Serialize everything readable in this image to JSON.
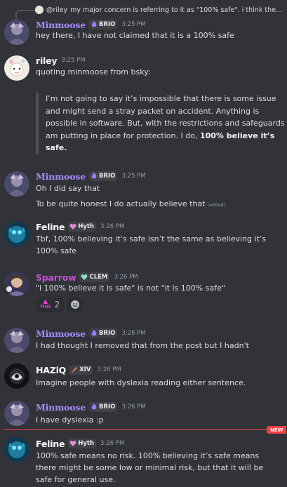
{
  "colors": {
    "background": "#313338",
    "minmoose": "#a88bff",
    "riley": "#f2f3f5",
    "feline": "#ffffff",
    "sparrow": "#c450d6",
    "haziq": "#ffffff",
    "new_marker": "#f23f43"
  },
  "reply": {
    "mention": "@riley",
    "text": "my major concern is referring to it as \"100% safe\". i think the..."
  },
  "messages": {
    "m1": {
      "username": "Minmoose",
      "tag": "BRIO",
      "time": "3:25 PM",
      "line1": "hey there, I have not claimed that it is a 100% safe"
    },
    "m2": {
      "username": "riley",
      "time": "3:25 PM",
      "line1": "quoting minmoose from bsky:",
      "quote_part1": "I’m not going to say it’s impossible that there is some issue and might send a stray packet on accident. Anything is possible in software. But, with the restrictions and safeguards I am putting in place for protection. I do, ",
      "quote_bold": "100% believe it’s safe."
    },
    "m3": {
      "username": "Minmoose",
      "tag": "BRIO",
      "time": "3:25 PM",
      "line1": "Oh I did say that",
      "line2": "To be quite honest I do actually believe that",
      "edited": "(edited)"
    },
    "m4": {
      "username": "Feline",
      "tag": "Hyth",
      "time": "3:26 PM",
      "line1": "Tbf, 100% believing it’s safe isn’t the same as believing it’s 100% safe"
    },
    "m5": {
      "username": "Sparrow",
      "tag": "CLEM",
      "time": "3:26 PM",
      "line1": "\"i 100% believe it is safe\" is not \"it is 100% safe\"",
      "reaction_label": "THIS",
      "reaction_count": "2"
    },
    "m6": {
      "username": "Minmoose",
      "tag": "BRIO",
      "time": "3:26 PM",
      "line1": "I had thought I removed that from the post but I hadn't"
    },
    "m7": {
      "username": "HAZiQ",
      "tag": "XIV",
      "time": "3:26 PM",
      "line1": "Imagine people with dyslexia reading either sentence."
    },
    "m8": {
      "username": "Minmoose",
      "tag": "BRIO",
      "time": "3:26 PM",
      "line1": "I have dyslexia :p"
    },
    "m9": {
      "username": "Feline",
      "tag": "Hyth",
      "time": "3:26 PM",
      "line1": "100% safe means no risk. 100% believing it’s safe means there might be some low or minimal risk, but that it will be safe for general use."
    }
  },
  "new_marker": "NEW"
}
